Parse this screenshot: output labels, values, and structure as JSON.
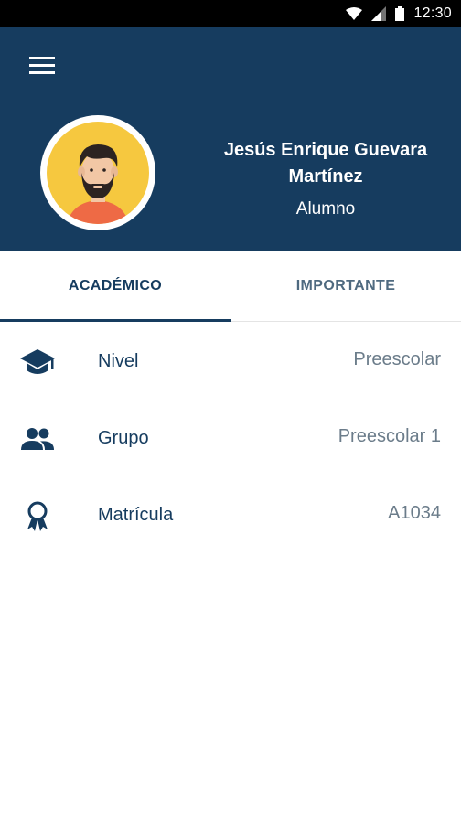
{
  "status_bar": {
    "time": "12:30"
  },
  "header": {
    "name": "Jesús Enrique Guevara Martínez",
    "role": "Alumno",
    "background": "#163c5f"
  },
  "tabs": [
    {
      "label": "ACADÉMICO",
      "active": true
    },
    {
      "label": "IMPORTANTE",
      "active": false
    }
  ],
  "rows": [
    {
      "icon": "graduation-cap-icon",
      "label": "Nivel",
      "value": "Preescolar"
    },
    {
      "icon": "group-icon",
      "label": "Grupo",
      "value": "Preescolar 1"
    },
    {
      "icon": "award-badge-icon",
      "label": "Matrícula",
      "value": "A1034"
    }
  ]
}
